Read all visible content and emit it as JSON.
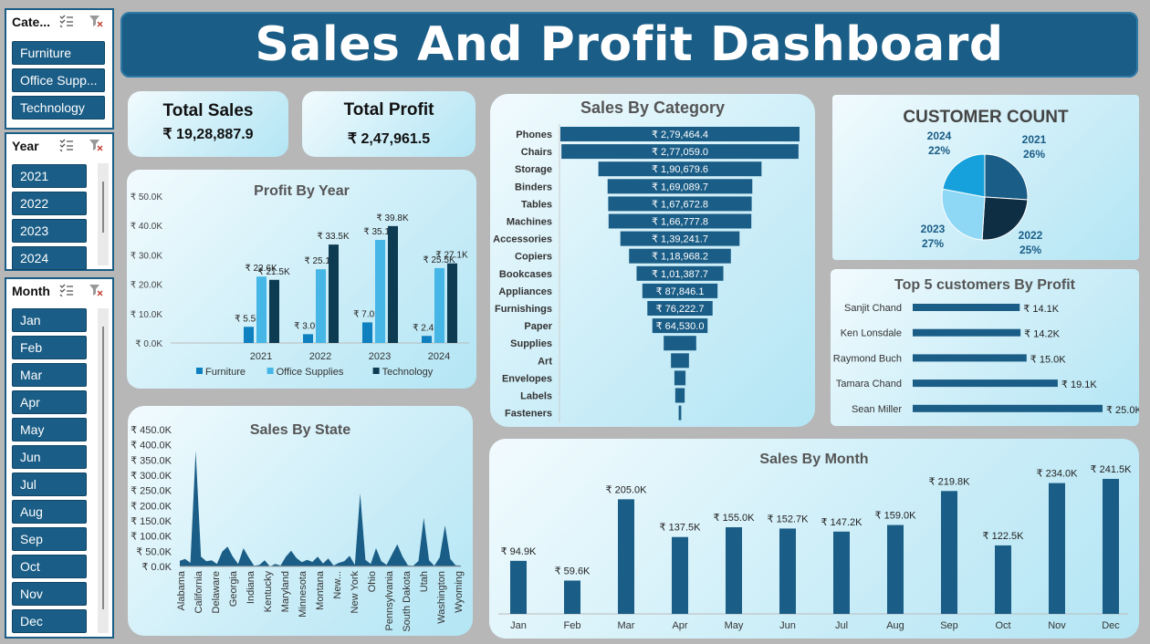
{
  "title": "Sales And Profit Dashboard",
  "colors": {
    "dark": "#1a5d86",
    "mid": "#0e7fbf",
    "light": "#45b6e6",
    "navy": "#0d3b52"
  },
  "slicers": {
    "category": {
      "title": "Cate...",
      "items": [
        "Furniture",
        "Office Supp...",
        "Technology"
      ]
    },
    "year": {
      "title": "Year",
      "items": [
        "2021",
        "2022",
        "2023",
        "2024"
      ]
    },
    "month": {
      "title": "Month",
      "items": [
        "Jan",
        "Feb",
        "Mar",
        "Apr",
        "May",
        "Jun",
        "Jul",
        "Aug",
        "Sep",
        "Oct",
        "Nov",
        "Dec"
      ]
    },
    "icons": [
      "multi-select-icon",
      "clear-filter-icon"
    ]
  },
  "kpis": {
    "sales": {
      "label": "Total Sales",
      "value": "₹ 19,28,887.9"
    },
    "profit": {
      "label": "Total Profit",
      "value": "₹ 2,47,961.5"
    }
  },
  "chart_data": [
    {
      "type": "bar",
      "title": "Profit By Year",
      "categories": [
        "2021",
        "2022",
        "2023",
        "2024"
      ],
      "yticks": [
        "₹ 0.0K",
        "₹ 10.0K",
        "₹ 20.0K",
        "₹ 30.0K",
        "₹ 40.0K",
        "₹ 50.0K"
      ],
      "ylim": [
        0,
        50000
      ],
      "legend": "bottom",
      "series": [
        {
          "name": "Furniture",
          "values": [
            5500,
            3000,
            7000,
            2400
          ],
          "labels": [
            "₹ 5.5K",
            "₹ 3.0K",
            "₹ 7.0K",
            "₹ 2.4K"
          ]
        },
        {
          "name": "Office Supplies",
          "values": [
            22600,
            25100,
            35100,
            25500
          ],
          "labels": [
            "₹ 22.6K",
            "₹ 25.1K",
            "₹ 35.1K",
            "₹ 25.5K"
          ]
        },
        {
          "name": "Technology",
          "values": [
            21500,
            33500,
            39800,
            27100
          ],
          "labels": [
            "₹ 21.5K",
            "₹ 33.5K",
            "₹ 39.8K",
            "₹ 27.1K"
          ]
        }
      ]
    },
    {
      "type": "bar",
      "title": "Sales By Category",
      "orientation": "horizontal-funnel",
      "categories": [
        "Phones",
        "Chairs",
        "Storage",
        "Binders",
        "Tables",
        "Machines",
        "Accessories",
        "Copiers",
        "Bookcases",
        "Appliances",
        "Furnishings",
        "Paper",
        "Supplies",
        "Art",
        "Envelopes",
        "Labels",
        "Fasteners"
      ],
      "values": [
        279464.4,
        277059.0,
        190679.6,
        169089.7,
        167672.8,
        166777.8,
        139241.7,
        118968.2,
        101387.7,
        87846.1,
        76222.7,
        64530.0,
        38000,
        21000,
        13000,
        11000,
        3000
      ],
      "labels": [
        "₹ 2,79,464.4",
        "₹ 2,77,059.0",
        "₹ 1,90,679.6",
        "₹ 1,69,089.7",
        "₹ 1,67,672.8",
        "₹ 1,66,777.8",
        "₹ 1,39,241.7",
        "₹ 1,18,968.2",
        "₹ 1,01,387.7",
        "₹ 87,846.1",
        "₹ 76,222.7",
        "₹ 64,530.0",
        "",
        "",
        "",
        "",
        ""
      ]
    },
    {
      "type": "pie",
      "title": "CUSTOMER COUNT",
      "categories": [
        "2021",
        "2022",
        "2023",
        "2024"
      ],
      "values": [
        26,
        25,
        27,
        22
      ],
      "labels": [
        "26%",
        "25%",
        "27%",
        "22%"
      ]
    },
    {
      "type": "bar",
      "title": "Top 5 customers By Profit",
      "orientation": "horizontal",
      "categories": [
        "Sanjit Chand",
        "Ken Lonsdale",
        "Raymond Buch",
        "Tamara Chand",
        "Sean Miller"
      ],
      "values": [
        14100,
        14200,
        15000,
        19100,
        25000
      ],
      "labels": [
        "₹ 14.1K",
        "₹ 14.2K",
        "₹ 15.0K",
        "₹ 19.1K",
        "₹ 25.0K"
      ]
    },
    {
      "type": "area",
      "title": "Sales By State",
      "yticks": [
        "₹ 0.0K",
        "₹ 50.0K",
        "₹ 100.0K",
        "₹ 150.0K",
        "₹ 200.0K",
        "₹ 250.0K",
        "₹ 300.0K",
        "₹ 350.0K",
        "₹ 400.0K",
        "₹ 450.0K"
      ],
      "ylim": [
        0,
        450000
      ],
      "xticks": [
        "Alabama",
        "California",
        "Delaware",
        "Georgia",
        "Indiana",
        "Kentucky",
        "Maryland",
        "Minnesota",
        "Montana",
        "New...",
        "New York",
        "Ohio",
        "Pennsylvania",
        "South Dakota",
        "Utah",
        "Washington",
        "Wyoming"
      ],
      "values": [
        19000,
        25000,
        12000,
        380000,
        32000,
        17000,
        20000,
        8000,
        49000,
        65000,
        32000,
        8000,
        60000,
        30000,
        2000,
        5000,
        20000,
        0,
        8000,
        3000,
        32000,
        52000,
        28000,
        14000,
        22000,
        15000,
        32000,
        10000,
        26000,
        3000,
        12000,
        17000,
        35000,
        5000,
        240000,
        22000,
        8000,
        60000,
        17000,
        5000,
        40000,
        73000,
        32000,
        4000,
        2000,
        18000,
        160000,
        20000,
        2000,
        30000,
        135000,
        25000,
        4000,
        3000
      ]
    },
    {
      "type": "bar",
      "title": "Sales By Month",
      "categories": [
        "Jan",
        "Feb",
        "Mar",
        "Apr",
        "May",
        "Jun",
        "Jul",
        "Aug",
        "Sep",
        "Oct",
        "Nov",
        "Dec"
      ],
      "values": [
        94900,
        59600,
        205000,
        137500,
        155000,
        152700,
        147200,
        159000,
        219800,
        122500,
        234000,
        241500
      ],
      "labels": [
        "₹ 94.9K",
        "₹ 59.6K",
        "₹ 205.0K",
        "₹ 137.5K",
        "₹ 155.0K",
        "₹ 152.7K",
        "₹ 147.2K",
        "₹ 159.0K",
        "₹ 219.8K",
        "₹ 122.5K",
        "₹ 234.0K",
        "₹ 241.5K"
      ]
    }
  ]
}
